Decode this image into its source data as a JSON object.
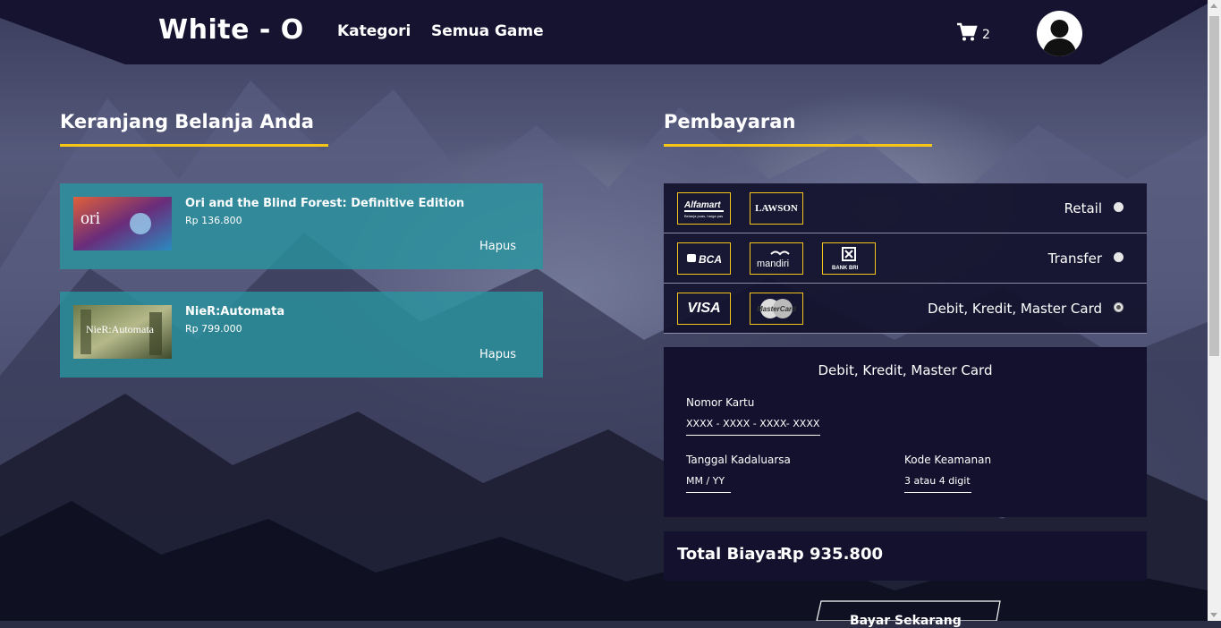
{
  "navbar": {
    "brand": "White - O",
    "links": [
      "Kategori",
      "Semua Game"
    ],
    "cart_count": "2"
  },
  "cart": {
    "title": "Keranjang Belanja Anda",
    "remove_label": "Hapus",
    "items": [
      {
        "name": "Ori and the Blind Forest: Definitive Edition",
        "price": "Rp 136.800",
        "thumb_text": "ori"
      },
      {
        "name": "NieR:Automata",
        "price": "Rp 799.000",
        "thumb_text": "NieR:Automata"
      }
    ]
  },
  "payment": {
    "title": "Pembayaran",
    "methods": [
      {
        "label": "Retail",
        "logos": [
          "Alfamart",
          "LAWSON"
        ],
        "selected": false
      },
      {
        "label": "Transfer",
        "logos": [
          "BCA",
          "mandiri",
          "BANK BRI"
        ],
        "selected": false
      },
      {
        "label": "Debit, Kredit, Master Card",
        "logos": [
          "VISA",
          "MasterCard"
        ],
        "selected": true
      }
    ],
    "logo_texts": {
      "alfamart": "Alfamart",
      "alfamart_sub": "Belanja puas, harga pas",
      "lawson": "LAWSON",
      "bca": "BCA",
      "mandiri": "mandiri",
      "bri": "BANK BRI",
      "visa": "VISA",
      "mastercard": "MasterCard"
    },
    "card_form": {
      "title": "Debit, Kredit, Master Card",
      "card_number_label": "Nomor Kartu",
      "card_number_placeholder": "XXXX - XXXX - XXXX- XXXX",
      "expiry_label": "Tanggal Kadaluarsa",
      "expiry_placeholder": "MM / YY",
      "cvv_label": "Kode Keamanan",
      "cvv_placeholder": "3 atau 4 digit"
    },
    "total_label": "Total Biaya:",
    "total_value": "Rp 935.800",
    "pay_button": "Bayar Sekarang"
  },
  "colors": {
    "accent": "#f5c518",
    "panel": "#13112d",
    "cart_item": "#2896a0"
  }
}
